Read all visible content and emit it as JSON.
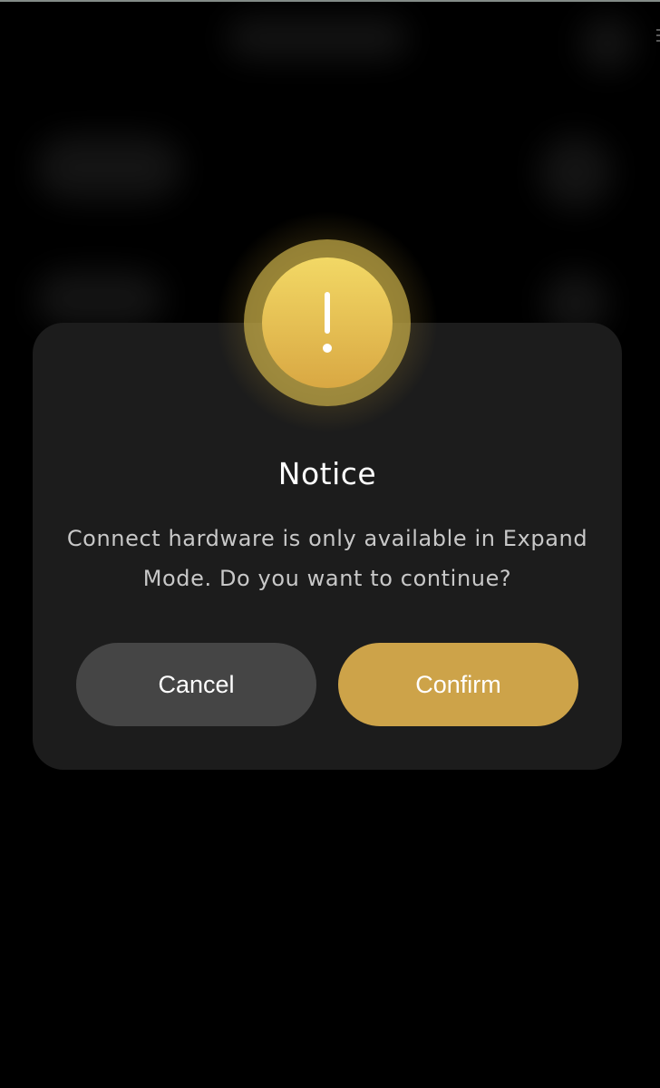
{
  "dialog": {
    "icon": "exclamation-icon",
    "title": "Notice",
    "message": "Connect hardware is only available in Expand Mode. Do you want to continue?",
    "cancel_label": "Cancel",
    "confirm_label": "Confirm"
  },
  "colors": {
    "background": "#000000",
    "dialog_background": "#1c1c1c",
    "cancel_button": "#454545",
    "confirm_button": "#cda349",
    "icon_gradient_top": "#f2d865",
    "icon_gradient_bottom": "#d9a843",
    "title_text": "#ffffff",
    "message_text": "#c8c8c8"
  }
}
